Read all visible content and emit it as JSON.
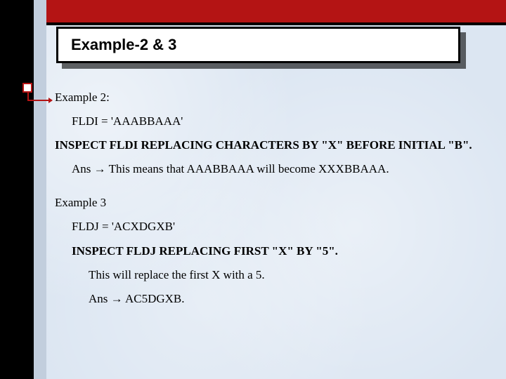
{
  "title": "Example-2 & 3",
  "ex2": {
    "heading": "Example 2:",
    "fldi": "FLDI =  'AAABBAAA'",
    "code": "INSPECT FLDI REPLACING CHARACTERS BY \"X\"   BEFORE INITIAL \"B\".",
    "ans": "Ans → This means that AAABBAAA will become XXXBBAAA."
  },
  "ex3": {
    "heading": "Example 3",
    "fldj": "FLDJ = 'ACXDGXB'",
    "code": "INSPECT FLDJ   REPLACING FIRST \"X\" BY \"5\".",
    "explain": "This will replace the first X with a 5.",
    "ans": "Ans → AC5DGXB."
  }
}
